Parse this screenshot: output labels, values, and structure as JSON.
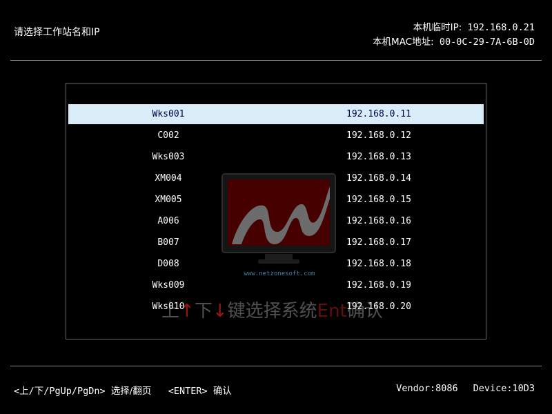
{
  "header": {
    "title": "请选择工作站名和IP",
    "ip_label": "本机临时IP:",
    "ip_value": "192.168.0.21",
    "mac_label": "本机MAC地址:",
    "mac_value": "00-0C-29-7A-6B-0D"
  },
  "list": {
    "selected_index": 0,
    "rows": [
      {
        "name": "Wks001",
        "ip": "192.168.0.11"
      },
      {
        "name": "C002",
        "ip": "192.168.0.12"
      },
      {
        "name": "Wks003",
        "ip": "192.168.0.13"
      },
      {
        "name": "XM004",
        "ip": "192.168.0.14"
      },
      {
        "name": "XM005",
        "ip": "192.168.0.15"
      },
      {
        "name": "A006",
        "ip": "192.168.0.16"
      },
      {
        "name": "B007",
        "ip": "192.168.0.17"
      },
      {
        "name": "D008",
        "ip": "192.168.0.18"
      },
      {
        "name": "Wks009",
        "ip": "192.168.0.19"
      },
      {
        "name": "Wks010",
        "ip": "192.168.0.20"
      }
    ]
  },
  "watermark": {
    "logo_url": "www.netzonesoft.com",
    "hint_up": "上",
    "arrow_up": "↑",
    "hint_down": "下",
    "arrow_down": "↓",
    "hint_mid": "键选择系统",
    "hint_ent": "Ent",
    "hint_end": "确认"
  },
  "footer": {
    "nav_hint": "<上/下/PgUp/PgDn>",
    "nav_action": "选择/翻页",
    "enter_hint": "<ENTER>",
    "enter_action": "确认",
    "vendor": "Vendor:8086",
    "device": "Device:10D3"
  },
  "colors": {
    "background": "#000000",
    "selection": "#d8edf8",
    "selected_text": "#00004a",
    "logo_red": "#8b0000"
  }
}
